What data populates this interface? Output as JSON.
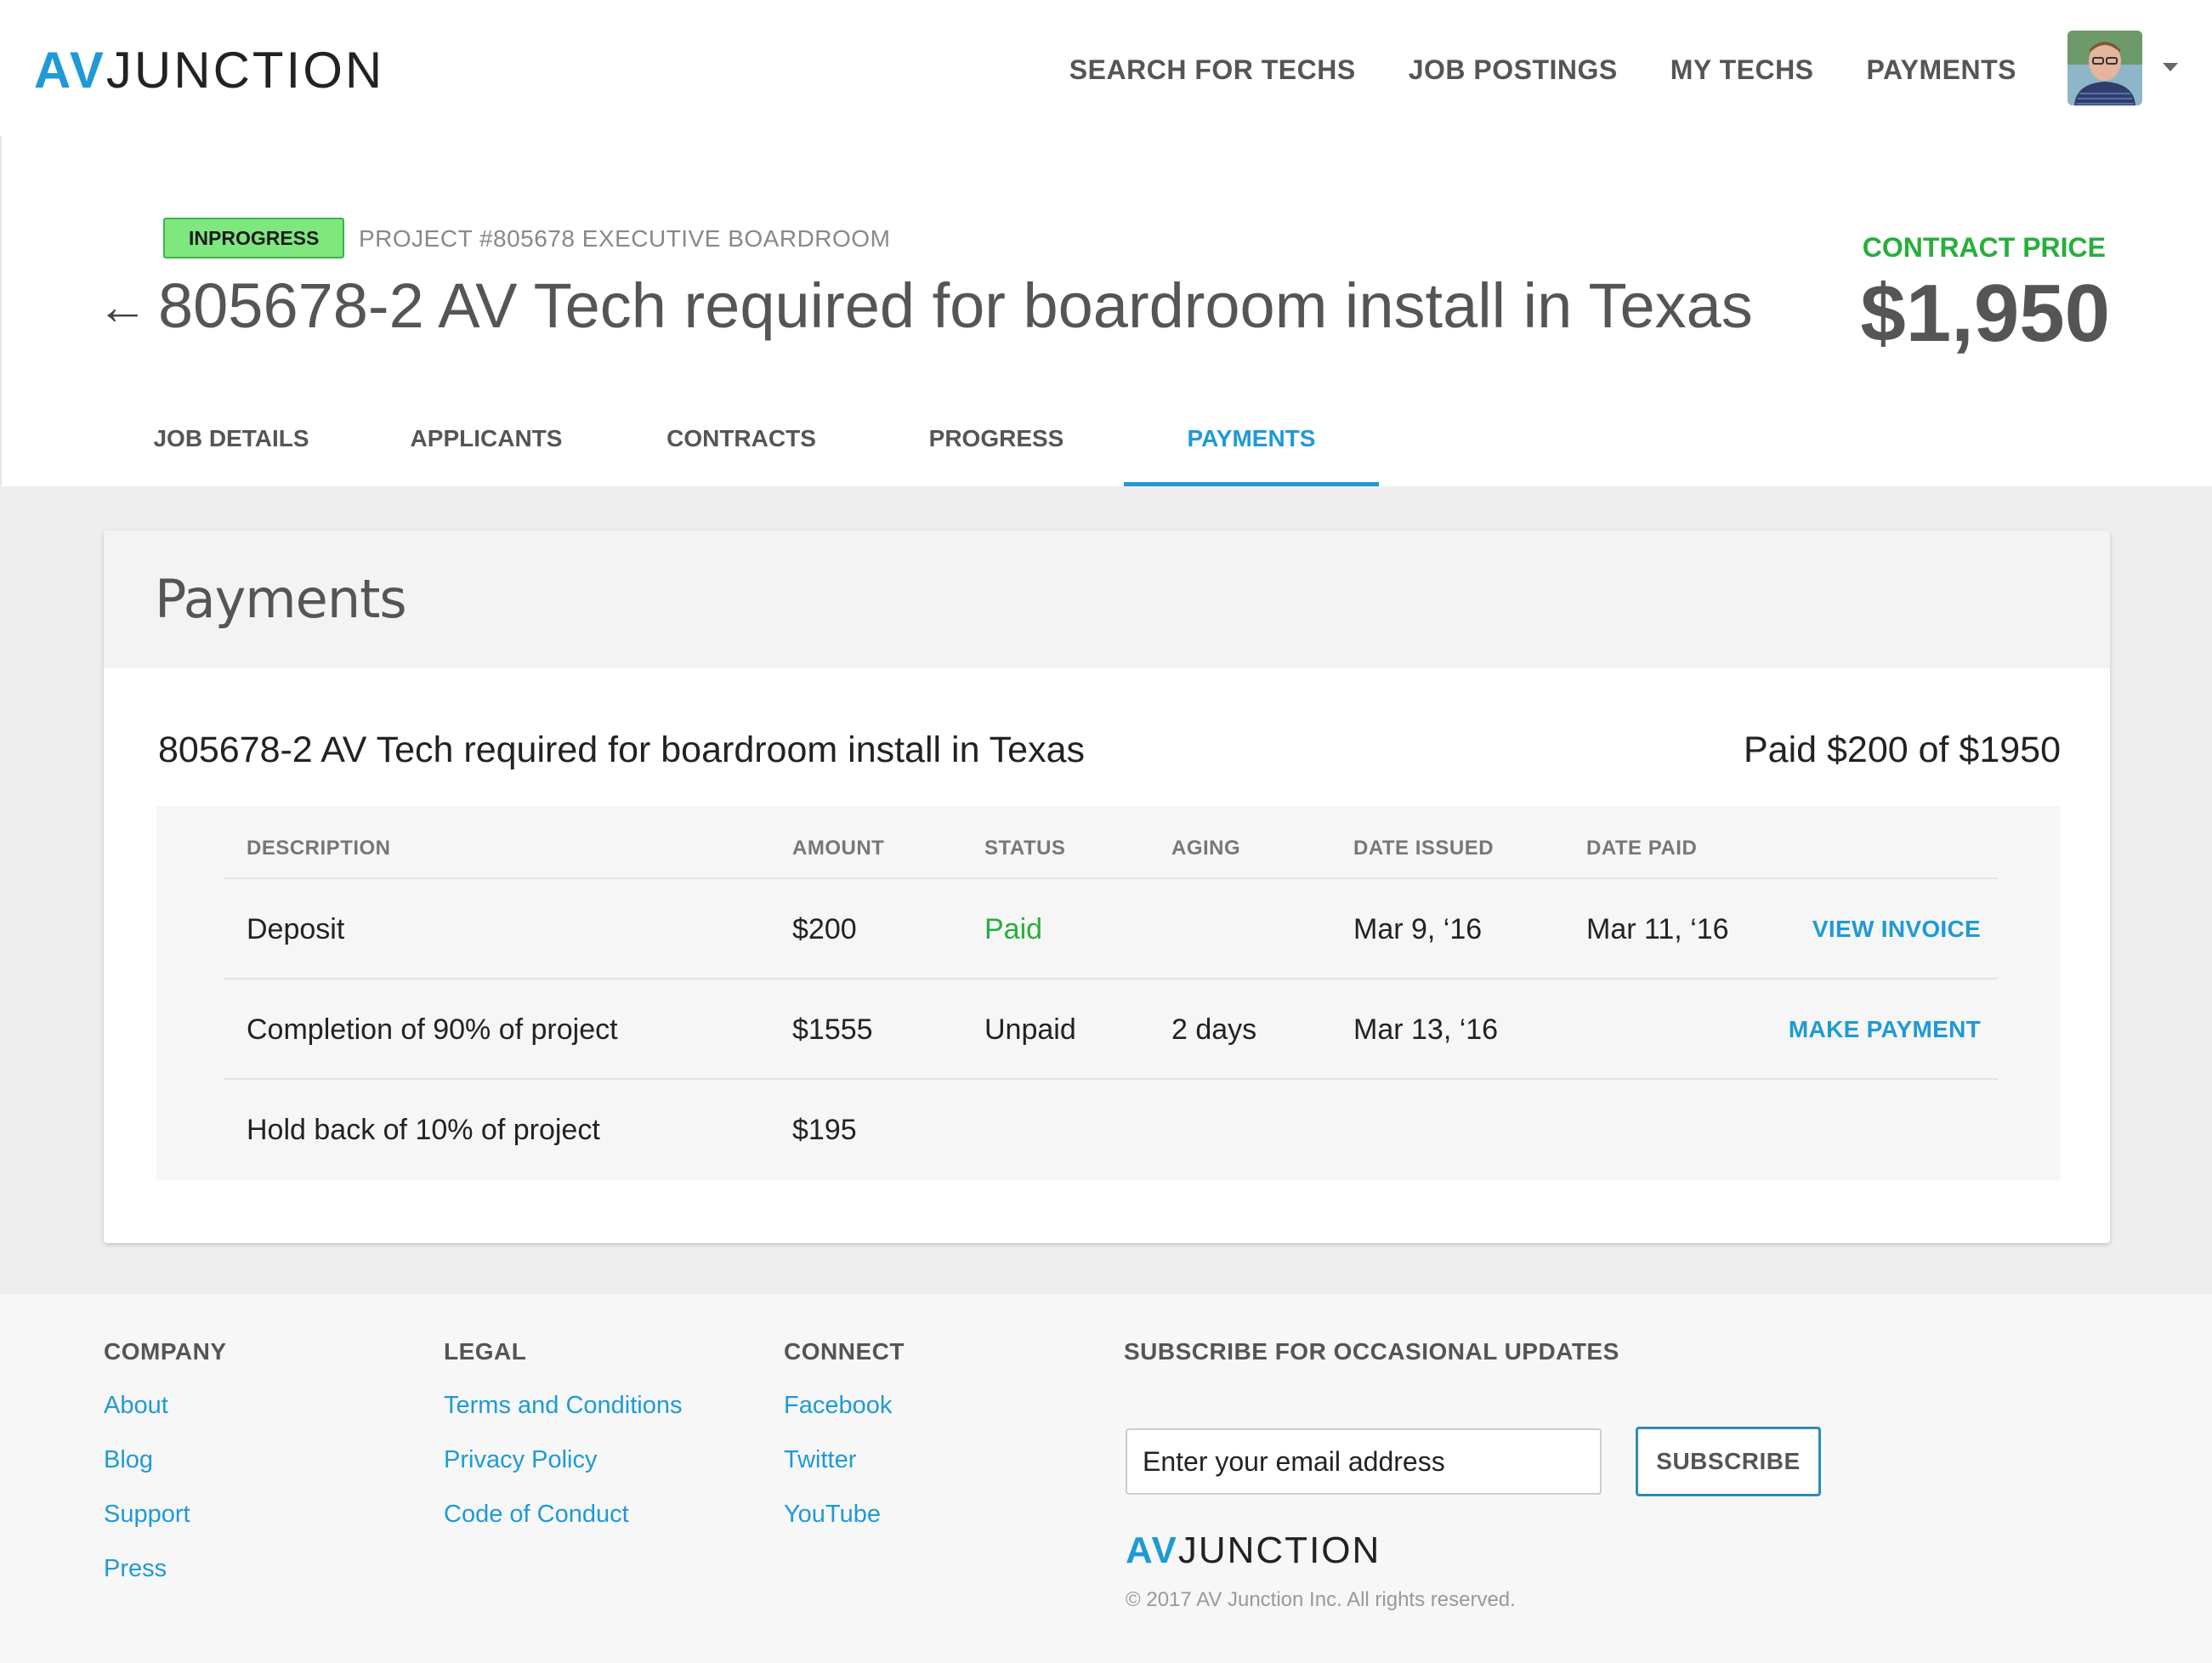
{
  "brand": {
    "logo_av": "AV",
    "logo_junction": "JUNCTION"
  },
  "nav": {
    "items": [
      {
        "label": "SEARCH FOR TECHS"
      },
      {
        "label": "JOB POSTINGS"
      },
      {
        "label": "MY TECHS"
      },
      {
        "label": "PAYMENTS"
      }
    ]
  },
  "header": {
    "status": "INPROGRESS",
    "project_label": "PROJECT #805678 EXECUTIVE BOARDROOM",
    "back_icon": "←",
    "title": "805678-2 AV Tech required for boardroom install in Texas",
    "contract_label": "CONTRACT PRICE",
    "contract_value": "$1,950"
  },
  "tabs": [
    {
      "label": "JOB DETAILS",
      "active": false
    },
    {
      "label": "APPLICANTS",
      "active": false
    },
    {
      "label": "CONTRACTS",
      "active": false
    },
    {
      "label": "PROGRESS",
      "active": false
    },
    {
      "label": "PAYMENTS",
      "active": true
    }
  ],
  "payments": {
    "card_title": "Payments",
    "job_name": "805678-2 AV Tech required for boardroom install in Texas",
    "paid_summary": "Paid $200 of $1950",
    "columns": [
      "DESCRIPTION",
      "AMOUNT",
      "STATUS",
      "AGING",
      "DATE ISSUED",
      "DATE PAID"
    ],
    "rows": [
      {
        "description": "Deposit",
        "amount": "$200",
        "status": "Paid",
        "aging": "",
        "date_issued": "Mar 9, ‘16",
        "date_paid": "Mar 11, ‘16",
        "action": "VIEW INVOICE"
      },
      {
        "description": "Completion of 90% of project",
        "amount": "$1555",
        "status": "Unpaid",
        "aging": "2 days",
        "date_issued": "Mar 13, ‘16",
        "date_paid": "",
        "action": "MAKE PAYMENT"
      },
      {
        "description": "Hold back of 10% of project",
        "amount": "$195",
        "status": "",
        "aging": "",
        "date_issued": "",
        "date_paid": "",
        "action": ""
      }
    ]
  },
  "footer": {
    "company": {
      "heading": "COMPANY",
      "links": [
        "About",
        "Blog",
        "Support",
        "Press"
      ]
    },
    "legal": {
      "heading": "LEGAL",
      "links": [
        "Terms and Conditions",
        "Privacy Policy",
        "Code of Conduct"
      ]
    },
    "connect": {
      "heading": "CONNECT",
      "links": [
        "Facebook",
        "Twitter",
        "YouTube"
      ]
    },
    "subscribe": {
      "heading": "SUBSCRIBE FOR OCCASIONAL UPDATES",
      "placeholder": "Enter your email address",
      "button": "SUBSCRIBE"
    },
    "logo_av": "AV",
    "logo_junction": "JUNCTION",
    "copyright": "© 2017 AV Junction Inc. All rights reserved."
  },
  "colors": {
    "accent": "#1e9ad6",
    "success": "#27ae3c",
    "badge_bg": "#7ee87e"
  },
  "icons": {
    "back": "arrow-left-icon",
    "caret": "caret-down-icon",
    "avatar": "user-avatar"
  }
}
